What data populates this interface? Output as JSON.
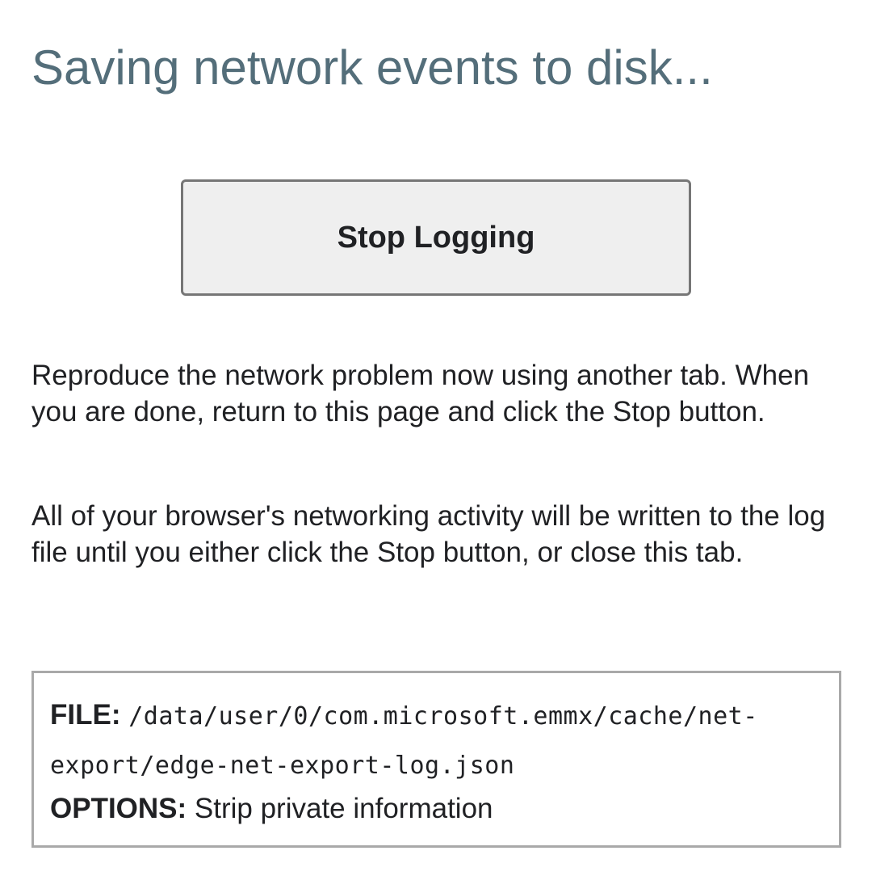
{
  "header": {
    "title": "Saving network events to disk..."
  },
  "actions": {
    "stop_label": "Stop Logging"
  },
  "instructions": {
    "paragraph_1": "Reproduce the network problem now using another tab. When you are done, return to this page and click the Stop button.",
    "paragraph_2": "All of your browser's networking activity will be written to the log file until you either click the Stop button, or close this tab."
  },
  "details": {
    "file_label": "FILE:",
    "file_path": "/data/user/0/com.microsoft.emmx/cache/net-export/edge-net-export-log.json",
    "options_label": "OPTIONS:",
    "options_value": "Strip private information"
  }
}
